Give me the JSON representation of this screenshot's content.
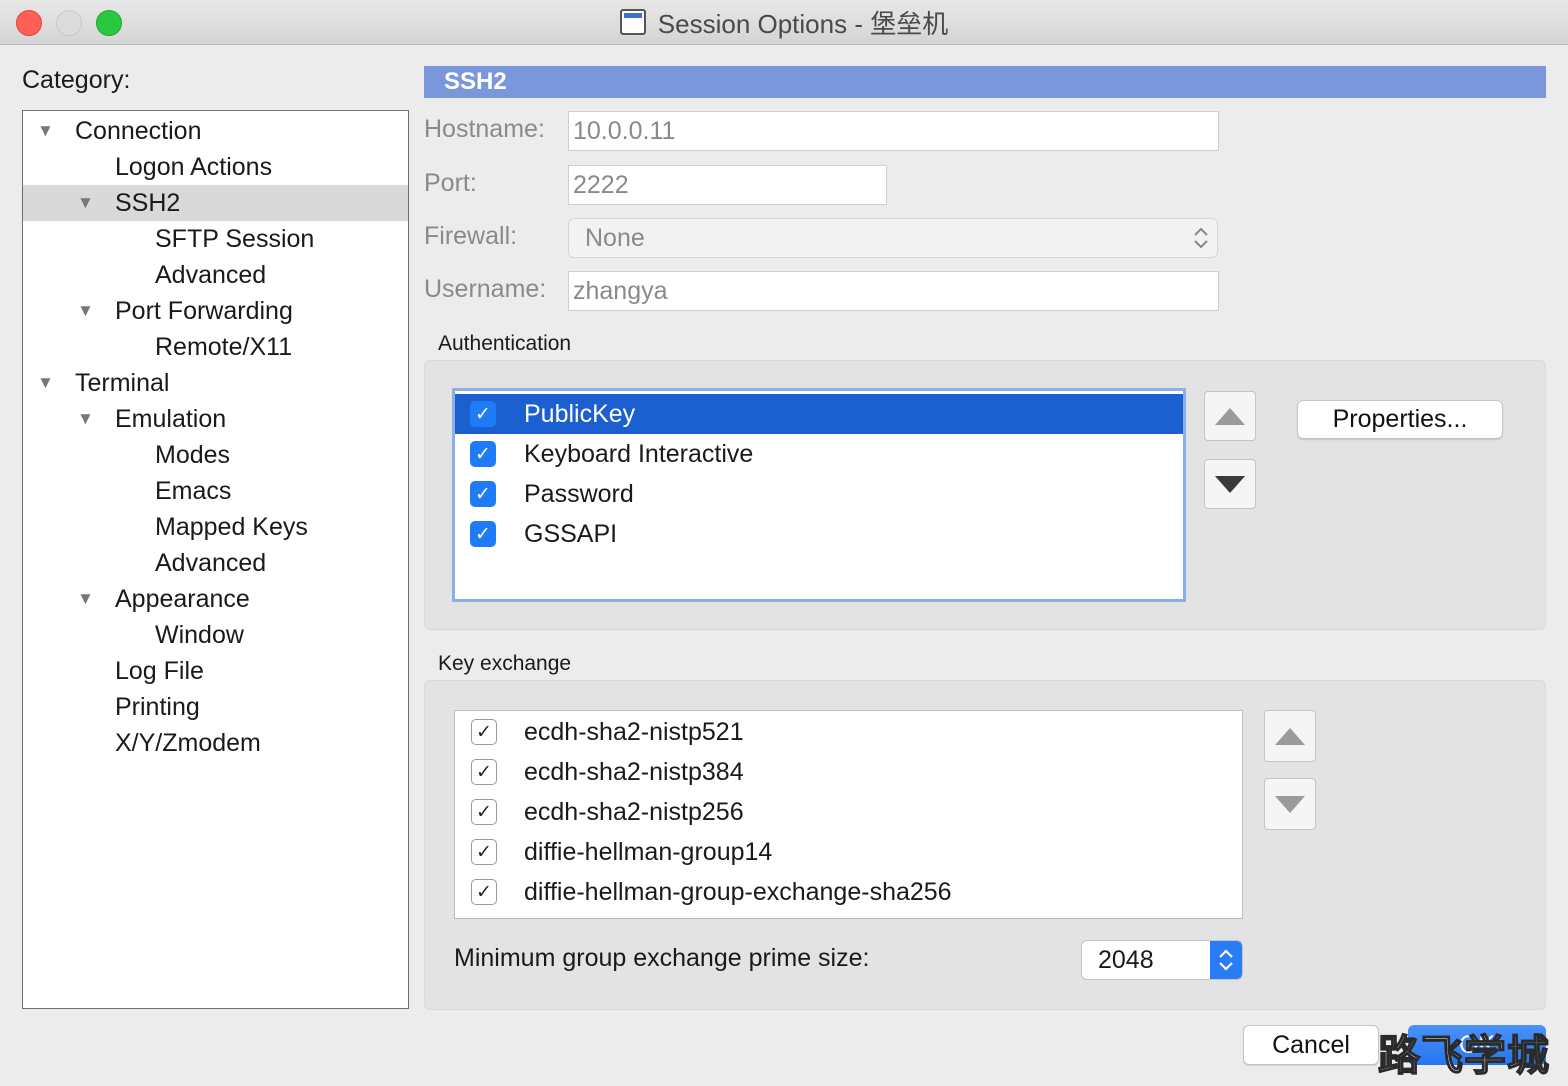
{
  "window": {
    "title": "Session Options - 堡垒机"
  },
  "category": {
    "label": "Category:",
    "tree": [
      {
        "label": "Connection",
        "expandable": true,
        "selected": false
      },
      {
        "label": "Logon Actions",
        "expandable": false,
        "selected": false
      },
      {
        "label": "SSH2",
        "expandable": true,
        "selected": true
      },
      {
        "label": "SFTP Session",
        "expandable": false,
        "selected": false
      },
      {
        "label": "Advanced",
        "expandable": false,
        "selected": false
      },
      {
        "label": "Port Forwarding",
        "expandable": true,
        "selected": false
      },
      {
        "label": "Remote/X11",
        "expandable": false,
        "selected": false
      },
      {
        "label": "Terminal",
        "expandable": true,
        "selected": false
      },
      {
        "label": "Emulation",
        "expandable": true,
        "selected": false
      },
      {
        "label": "Modes",
        "expandable": false,
        "selected": false
      },
      {
        "label": "Emacs",
        "expandable": false,
        "selected": false
      },
      {
        "label": "Mapped Keys",
        "expandable": false,
        "selected": false
      },
      {
        "label": "Advanced",
        "expandable": false,
        "selected": false
      },
      {
        "label": "Appearance",
        "expandable": true,
        "selected": false
      },
      {
        "label": "Window",
        "expandable": false,
        "selected": false
      },
      {
        "label": "Log File",
        "expandable": false,
        "selected": false
      },
      {
        "label": "Printing",
        "expandable": false,
        "selected": false
      },
      {
        "label": "X/Y/Zmodem",
        "expandable": false,
        "selected": false
      }
    ]
  },
  "ssh2": {
    "header": "SSH2",
    "hostname": {
      "label": "Hostname:",
      "value": "10.0.0.11"
    },
    "port": {
      "label": "Port:",
      "value": "2222"
    },
    "firewall": {
      "label": "Firewall:",
      "value": "None"
    },
    "username": {
      "label": "Username:",
      "value": "zhangya"
    }
  },
  "authentication": {
    "label": "Authentication",
    "methods": [
      {
        "name": "PublicKey",
        "checked": true,
        "selected": true
      },
      {
        "name": "Keyboard Interactive",
        "checked": true,
        "selected": false
      },
      {
        "name": "Password",
        "checked": true,
        "selected": false
      },
      {
        "name": "GSSAPI",
        "checked": true,
        "selected": false
      }
    ],
    "properties_label": "Properties..."
  },
  "key_exchange": {
    "label": "Key exchange",
    "algorithms": [
      {
        "name": "ecdh-sha2-nistp521",
        "checked": true
      },
      {
        "name": "ecdh-sha2-nistp384",
        "checked": true
      },
      {
        "name": "ecdh-sha2-nistp256",
        "checked": true
      },
      {
        "name": "diffie-hellman-group14",
        "checked": true
      },
      {
        "name": "diffie-hellman-group-exchange-sha256",
        "checked": true
      }
    ],
    "prime_label": "Minimum group exchange prime size:",
    "prime_value": "2048"
  },
  "footer": {
    "cancel_label": "Cancel",
    "ok_label": "OK",
    "watermark": "路飞学城"
  },
  "colors": {
    "header_bg": "#7b97dc",
    "selection_blue": "#1c5fd0",
    "checkbox_blue": "#1f7cf6",
    "close_red": "#fe5f57",
    "max_green": "#28c840"
  },
  "icons": {
    "window_icon": "terminal-session-icon",
    "checkmark": "✓",
    "expand": "triangle-down"
  }
}
